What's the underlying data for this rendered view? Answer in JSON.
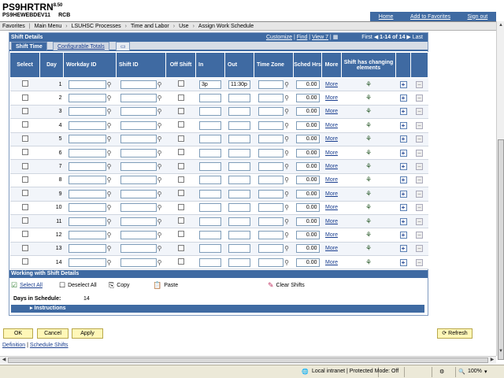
{
  "header": {
    "system": "PS9HRTRN",
    "version": "8.50",
    "db": "PS9HEWEBDEV11",
    "user": "RCB",
    "links": [
      "Home",
      "Add to Favorites",
      "Sign out"
    ]
  },
  "nav": {
    "items": [
      "Favorites",
      "Main Menu",
      "LSUHSC Processes",
      "Time and Labor",
      "Use",
      "Assign Work Schedule"
    ]
  },
  "panel": {
    "title": "Shift Details",
    "customize": "Customize",
    "find": "Find",
    "view": "View 7",
    "first": "First",
    "range": "1-14 of 14",
    "last": "Last",
    "tabs": [
      "Shift Time",
      "Configurable Totals"
    ]
  },
  "columns": [
    "Select",
    "Day",
    "Workday ID",
    "Shift ID",
    "Off Shift",
    "In",
    "Out",
    "Time Zone",
    "Sched Hrs",
    "More",
    "Shift has changing elements",
    "",
    ""
  ],
  "rows": [
    {
      "day": "1",
      "in": "3p",
      "out": "11:30p",
      "hrs": "0.00",
      "more": "More"
    },
    {
      "day": "2",
      "in": "",
      "out": "",
      "hrs": "0.00",
      "more": "More"
    },
    {
      "day": "3",
      "in": "",
      "out": "",
      "hrs": "0.00",
      "more": "More"
    },
    {
      "day": "4",
      "in": "",
      "out": "",
      "hrs": "0.00",
      "more": "More"
    },
    {
      "day": "5",
      "in": "",
      "out": "",
      "hrs": "0.00",
      "more": "More"
    },
    {
      "day": "6",
      "in": "",
      "out": "",
      "hrs": "0.00",
      "more": "More"
    },
    {
      "day": "7",
      "in": "",
      "out": "",
      "hrs": "0.00",
      "more": "More"
    },
    {
      "day": "8",
      "in": "",
      "out": "",
      "hrs": "0.00",
      "more": "More"
    },
    {
      "day": "9",
      "in": "",
      "out": "",
      "hrs": "0.00",
      "more": "More"
    },
    {
      "day": "10",
      "in": "",
      "out": "",
      "hrs": "0.00",
      "more": "More"
    },
    {
      "day": "11",
      "in": "",
      "out": "",
      "hrs": "0.00",
      "more": "More"
    },
    {
      "day": "12",
      "in": "",
      "out": "",
      "hrs": "0.00",
      "more": "More"
    },
    {
      "day": "13",
      "in": "",
      "out": "",
      "hrs": "0.00",
      "more": "More"
    },
    {
      "day": "14",
      "in": "",
      "out": "",
      "hrs": "0.00",
      "more": "More"
    }
  ],
  "working": {
    "title": "Working with Shift Details",
    "select_all": "Select All",
    "deselect_all": "Deselect All",
    "copy": "Copy",
    "paste": "Paste",
    "clear": "Clear Shifts",
    "days_label": "Days in Schedule:",
    "days_value": "14",
    "instructions": "Instructions"
  },
  "buttons": {
    "ok": "OK",
    "cancel": "Cancel",
    "apply": "Apply",
    "refresh": "Refresh"
  },
  "footer": {
    "definition": "Definition",
    "schedule": "Schedule Shifts"
  },
  "status": {
    "zone": "Local intranet | Protected Mode: Off",
    "zoom": "100%"
  },
  "colors": {
    "header_blue": "#3f6aa2",
    "button_yellow": "#fff7b8"
  }
}
